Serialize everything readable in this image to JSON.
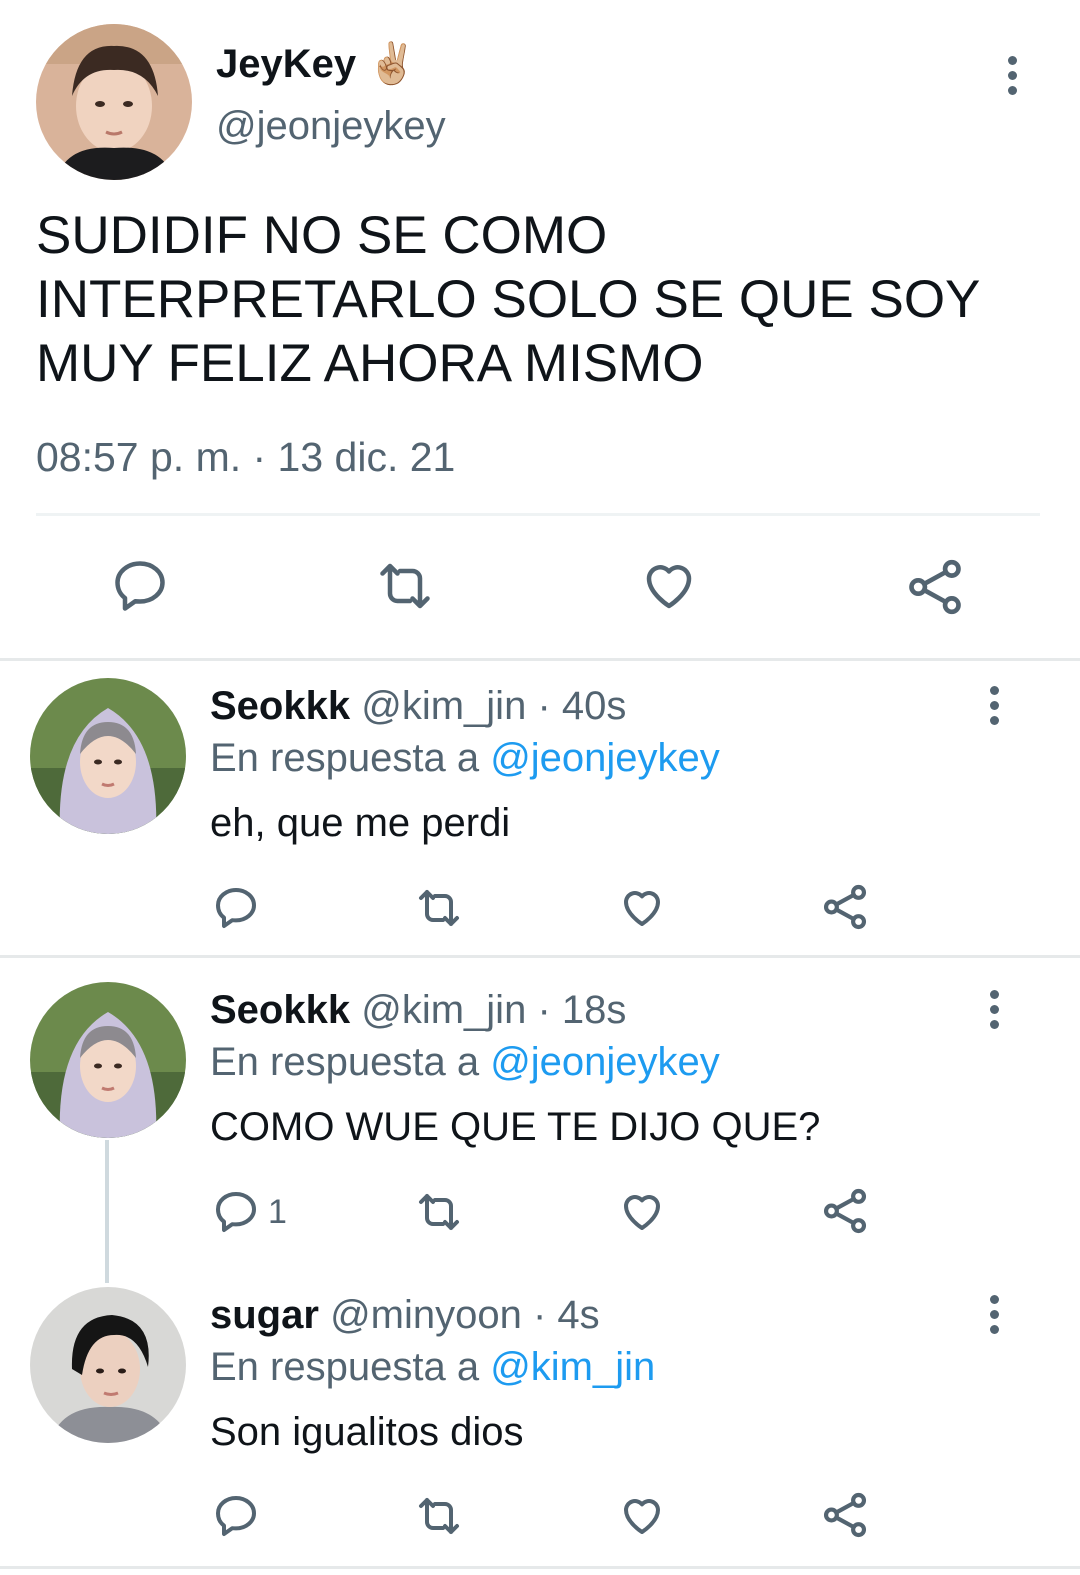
{
  "main_tweet": {
    "display_name": "JeyKey",
    "emoji": "✌🏼",
    "handle": "@jeonjeykey",
    "text": "SUDIDIF NO SE COMO INTERPRETARLO SOLO SE QUE SOY MUY FELIZ AHORA MISMO",
    "timestamp": "08:57 p. m. · 13 dic. 21",
    "avatar_icon": "avatar-photo"
  },
  "replies": [
    {
      "display_name": "Seokkk",
      "handle": "@kim_jin",
      "time": "· 40s",
      "reply_prefix": "En respuesta a",
      "reply_to": "@jeonjeykey",
      "text": "eh, que me perdi",
      "reply_count": ""
    },
    {
      "display_name": "Seokkk",
      "handle": "@kim_jin",
      "time": "· 18s",
      "reply_prefix": "En respuesta a",
      "reply_to": "@jeonjeykey",
      "text": "COMO WUE QUE TE DIJO QUE?",
      "reply_count": "1"
    },
    {
      "display_name": "sugar",
      "handle": "@minyoon",
      "time": "· 4s",
      "reply_prefix": "En respuesta a",
      "reply_to": "@kim_jin",
      "text": "Son igualitos dios",
      "reply_count": ""
    }
  ],
  "icons": {
    "reply": "speech-bubble-icon",
    "retweet": "retweet-icon",
    "like": "heart-icon",
    "share": "share-icon",
    "more": "vertical-dots-icon"
  },
  "colors": {
    "link": "#1d9bf0",
    "secondary_text": "#536471",
    "divider": "#eff3f4"
  }
}
